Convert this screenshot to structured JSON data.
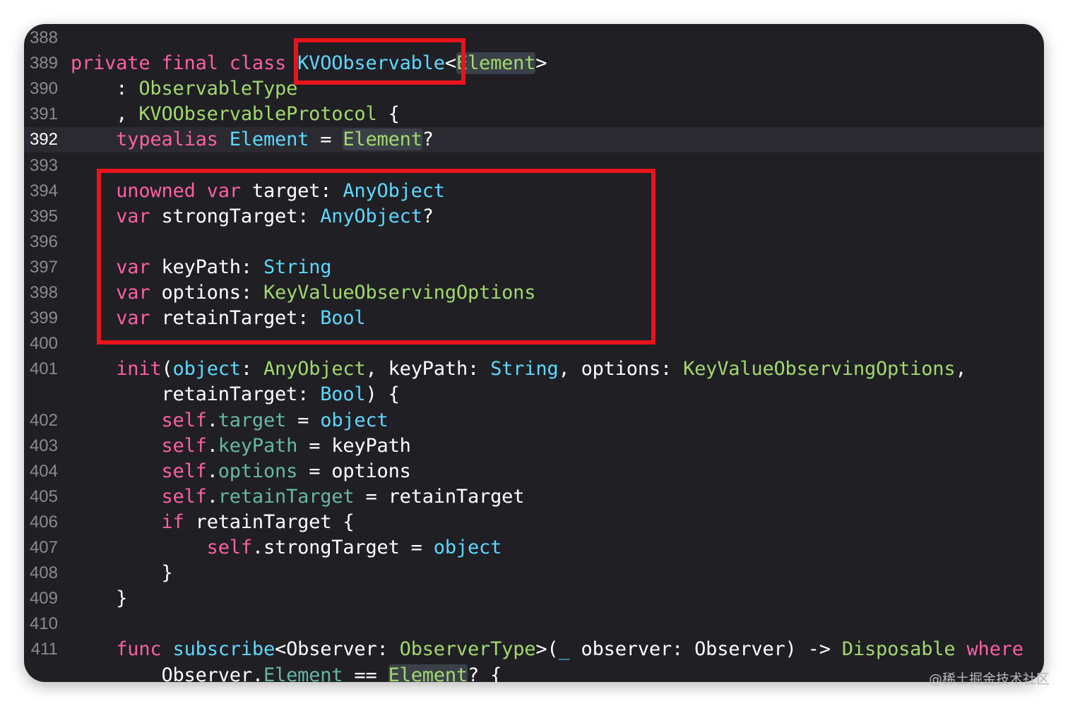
{
  "editor": {
    "lines": [
      {
        "num": "388",
        "current": false,
        "tokens": []
      },
      {
        "num": "389",
        "current": false,
        "tokens": [
          {
            "t": "private final class ",
            "c": "kw"
          },
          {
            "t": "KVOObservable",
            "c": "ty2"
          },
          {
            "t": "<",
            "c": ""
          },
          {
            "t": "Element",
            "c": "proj hl"
          },
          {
            "t": ">",
            "c": ""
          }
        ]
      },
      {
        "num": "390",
        "current": false,
        "tokens": [
          {
            "t": "    : ",
            "c": ""
          },
          {
            "t": "ObservableType",
            "c": "proj"
          }
        ]
      },
      {
        "num": "391",
        "current": false,
        "tokens": [
          {
            "t": "    , ",
            "c": ""
          },
          {
            "t": "KVOObservableProtocol",
            "c": "proj"
          },
          {
            "t": " {",
            "c": ""
          }
        ]
      },
      {
        "num": "392",
        "current": true,
        "tokens": [
          {
            "t": "    ",
            "c": ""
          },
          {
            "t": "typealias",
            "c": "kw"
          },
          {
            "t": " ",
            "c": ""
          },
          {
            "t": "Element",
            "c": "ty2"
          },
          {
            "t": " = ",
            "c": ""
          },
          {
            "t": "Element",
            "c": "proj hl"
          },
          {
            "t": "?",
            "c": ""
          }
        ]
      },
      {
        "num": "393",
        "current": false,
        "tokens": []
      },
      {
        "num": "394",
        "current": false,
        "tokens": [
          {
            "t": "    ",
            "c": ""
          },
          {
            "t": "unowned var",
            "c": "kw"
          },
          {
            "t": " target: ",
            "c": ""
          },
          {
            "t": "AnyObject",
            "c": "ty2"
          }
        ]
      },
      {
        "num": "395",
        "current": false,
        "tokens": [
          {
            "t": "    ",
            "c": ""
          },
          {
            "t": "var",
            "c": "kw"
          },
          {
            "t": " strongTarget: ",
            "c": ""
          },
          {
            "t": "AnyObject",
            "c": "ty2"
          },
          {
            "t": "?",
            "c": ""
          }
        ]
      },
      {
        "num": "396",
        "current": false,
        "tokens": []
      },
      {
        "num": "397",
        "current": false,
        "tokens": [
          {
            "t": "    ",
            "c": ""
          },
          {
            "t": "var",
            "c": "kw"
          },
          {
            "t": " keyPath: ",
            "c": ""
          },
          {
            "t": "String",
            "c": "ty2"
          }
        ]
      },
      {
        "num": "398",
        "current": false,
        "tokens": [
          {
            "t": "    ",
            "c": ""
          },
          {
            "t": "var",
            "c": "kw"
          },
          {
            "t": " options: ",
            "c": ""
          },
          {
            "t": "KeyValueObservingOptions",
            "c": "proj"
          }
        ]
      },
      {
        "num": "399",
        "current": false,
        "tokens": [
          {
            "t": "    ",
            "c": ""
          },
          {
            "t": "var",
            "c": "kw"
          },
          {
            "t": " retainTarget: ",
            "c": ""
          },
          {
            "t": "Bool",
            "c": "ty2"
          }
        ]
      },
      {
        "num": "400",
        "current": false,
        "tokens": []
      },
      {
        "num": "401",
        "current": false,
        "tokens": [
          {
            "t": "    ",
            "c": ""
          },
          {
            "t": "init",
            "c": "kw"
          },
          {
            "t": "(",
            "c": ""
          },
          {
            "t": "object",
            "c": "ty2"
          },
          {
            "t": ": ",
            "c": ""
          },
          {
            "t": "AnyObject",
            "c": "proj"
          },
          {
            "t": ", keyPath: ",
            "c": ""
          },
          {
            "t": "String",
            "c": "ty2"
          },
          {
            "t": ", options: ",
            "c": ""
          },
          {
            "t": "KeyValueObservingOptions",
            "c": "proj"
          },
          {
            "t": ",",
            "c": ""
          }
        ]
      },
      {
        "num": "",
        "current": false,
        "tokens": [
          {
            "t": "        retainTarget: ",
            "c": ""
          },
          {
            "t": "Bool",
            "c": "ty2"
          },
          {
            "t": ") {",
            "c": ""
          }
        ]
      },
      {
        "num": "402",
        "current": false,
        "tokens": [
          {
            "t": "        ",
            "c": ""
          },
          {
            "t": "self",
            "c": "kw"
          },
          {
            "t": ".",
            "c": ""
          },
          {
            "t": "target",
            "c": "fn"
          },
          {
            "t": " = ",
            "c": ""
          },
          {
            "t": "object",
            "c": "ty2"
          }
        ]
      },
      {
        "num": "403",
        "current": false,
        "tokens": [
          {
            "t": "        ",
            "c": ""
          },
          {
            "t": "self",
            "c": "kw"
          },
          {
            "t": ".",
            "c": ""
          },
          {
            "t": "keyPath",
            "c": "fn"
          },
          {
            "t": " = keyPath",
            "c": ""
          }
        ]
      },
      {
        "num": "404",
        "current": false,
        "tokens": [
          {
            "t": "        ",
            "c": ""
          },
          {
            "t": "self",
            "c": "kw"
          },
          {
            "t": ".",
            "c": ""
          },
          {
            "t": "options",
            "c": "fn"
          },
          {
            "t": " = options",
            "c": ""
          }
        ]
      },
      {
        "num": "405",
        "current": false,
        "tokens": [
          {
            "t": "        ",
            "c": ""
          },
          {
            "t": "self",
            "c": "kw"
          },
          {
            "t": ".",
            "c": ""
          },
          {
            "t": "retainTarget",
            "c": "fn"
          },
          {
            "t": " = retainTarget",
            "c": ""
          }
        ]
      },
      {
        "num": "406",
        "current": false,
        "tokens": [
          {
            "t": "        ",
            "c": ""
          },
          {
            "t": "if",
            "c": "kw"
          },
          {
            "t": " retainTarget {",
            "c": ""
          }
        ]
      },
      {
        "num": "407",
        "current": false,
        "tokens": [
          {
            "t": "            ",
            "c": ""
          },
          {
            "t": "self",
            "c": "kw"
          },
          {
            "t": ".strongTarget = ",
            "c": ""
          },
          {
            "t": "object",
            "c": "ty2"
          }
        ]
      },
      {
        "num": "408",
        "current": false,
        "tokens": [
          {
            "t": "        }",
            "c": ""
          }
        ]
      },
      {
        "num": "409",
        "current": false,
        "tokens": [
          {
            "t": "    }",
            "c": ""
          }
        ]
      },
      {
        "num": "410",
        "current": false,
        "tokens": []
      },
      {
        "num": "411",
        "current": false,
        "tokens": [
          {
            "t": "    ",
            "c": ""
          },
          {
            "t": "func",
            "c": "kw"
          },
          {
            "t": " ",
            "c": ""
          },
          {
            "t": "subscribe",
            "c": "ty2"
          },
          {
            "t": "<Observer: ",
            "c": ""
          },
          {
            "t": "ObserverType",
            "c": "proj"
          },
          {
            "t": ">(",
            "c": ""
          },
          {
            "t": "_",
            "c": "ty2"
          },
          {
            "t": " observer: Observer) -> ",
            "c": ""
          },
          {
            "t": "Disposable",
            "c": "proj"
          },
          {
            "t": " ",
            "c": ""
          },
          {
            "t": "where",
            "c": "kw"
          }
        ]
      },
      {
        "num": "",
        "current": false,
        "tokens": [
          {
            "t": "        Observer.",
            "c": ""
          },
          {
            "t": "Element",
            "c": "fn"
          },
          {
            "t": " == ",
            "c": ""
          },
          {
            "t": "Element",
            "c": "proj hl"
          },
          {
            "t": "? {",
            "c": ""
          }
        ]
      }
    ]
  },
  "colors": {
    "highlight_box": "#e8141b",
    "editor_background": "#1f1f24"
  },
  "watermark": "@稀土掘金技术社区"
}
